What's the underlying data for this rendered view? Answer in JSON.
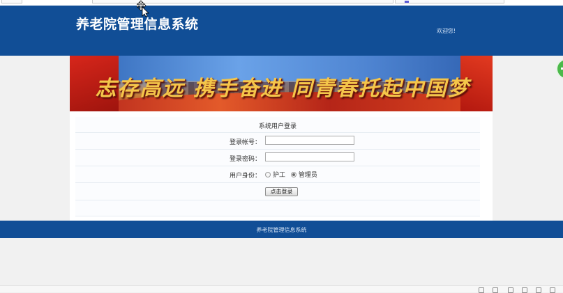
{
  "header": {
    "site_title": "养老院管理信息系统",
    "welcome_text": "欢迎您!"
  },
  "banner": {
    "slogan": "志存高远  携手奋进  同青春托起中国梦"
  },
  "login": {
    "title": "系统用户登录",
    "account_label": "登录帐号：",
    "account_value": "",
    "password_label": "登录密码：",
    "password_value": "",
    "role_label": "用户身份：",
    "roles": [
      {
        "label": "护工",
        "selected": false
      },
      {
        "label": "管理员",
        "selected": true
      }
    ],
    "submit_label": "点击登录"
  },
  "footer": {
    "text": "养老院管理信息系统"
  },
  "colors": {
    "header_bg": "#114e96",
    "page_bg": "#f1f1f1",
    "panel_bg": "#ffffff"
  }
}
